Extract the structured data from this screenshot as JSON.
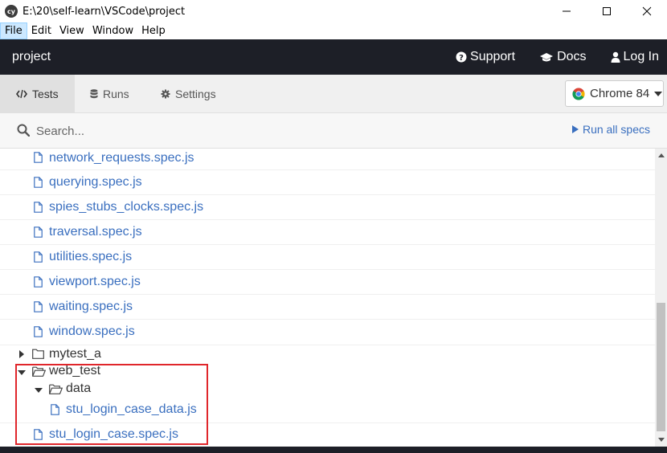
{
  "window": {
    "title": "E:\\20\\self-learn\\VSCode\\project",
    "logo_text": "cy"
  },
  "menu": [
    "File",
    "Edit",
    "View",
    "Window",
    "Help"
  ],
  "header": {
    "project": "project",
    "links": [
      {
        "label": "Support",
        "icon": "question-circle-icon"
      },
      {
        "label": "Docs",
        "icon": "graduation-cap-icon"
      },
      {
        "label": "Log In",
        "icon": "user-icon"
      }
    ]
  },
  "nav": {
    "tabs": [
      {
        "label": "Tests",
        "icon": "code-icon",
        "active": true
      },
      {
        "label": "Runs",
        "icon": "database-icon",
        "active": false
      },
      {
        "label": "Settings",
        "icon": "gear-icon",
        "active": false
      }
    ],
    "browser": "Chrome 84"
  },
  "search": {
    "placeholder": "Search...",
    "run_all": "Run all specs"
  },
  "specs": [
    {
      "type": "file",
      "label": "network_requests.spec.js",
      "depth": 1
    },
    {
      "type": "file",
      "label": "querying.spec.js",
      "depth": 1
    },
    {
      "type": "file",
      "label": "spies_stubs_clocks.spec.js",
      "depth": 1
    },
    {
      "type": "file",
      "label": "traversal.spec.js",
      "depth": 1
    },
    {
      "type": "file",
      "label": "utilities.spec.js",
      "depth": 1
    },
    {
      "type": "file",
      "label": "viewport.spec.js",
      "depth": 1
    },
    {
      "type": "file",
      "label": "waiting.spec.js",
      "depth": 1
    },
    {
      "type": "file",
      "label": "window.spec.js",
      "depth": 1
    },
    {
      "type": "folder",
      "label": "mytest_a",
      "depth": 0,
      "expanded": false
    },
    {
      "type": "folder",
      "label": "web_test",
      "depth": 0,
      "expanded": true
    },
    {
      "type": "folder",
      "label": "data",
      "depth": 1,
      "expanded": true
    },
    {
      "type": "file",
      "label": "stu_login_case_data.js",
      "depth": 2
    },
    {
      "type": "file",
      "label": "stu_login_case.spec.js",
      "depth": 1
    }
  ],
  "colors": {
    "header_bg": "#1d1f27",
    "link_blue": "#3a6fbf",
    "highlight_red": "#e0262b"
  }
}
